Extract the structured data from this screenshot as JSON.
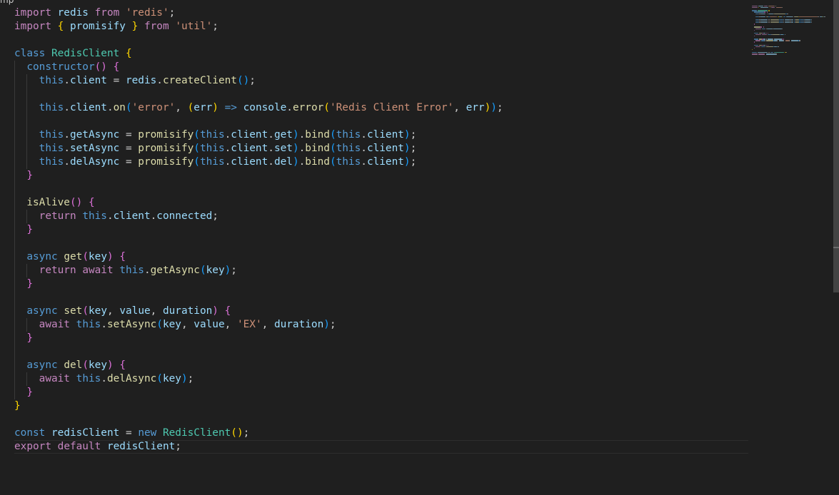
{
  "editor": {
    "breadcrumb": "mp",
    "language": "javascript",
    "cursor_line": 33
  },
  "colors": {
    "background": "#1f1f1f",
    "default": "#cccccc",
    "keyword": "#c586c0",
    "storage": "#569cd6",
    "class": "#4ec9b0",
    "function": "#dcdcaa",
    "string": "#ce9178",
    "variable": "#9cdcfe",
    "bracket1": "#ffd700",
    "bracket2": "#da70d6",
    "bracket3": "#179fff"
  },
  "code": {
    "lines": [
      {
        "indent": 0,
        "tokens": [
          {
            "t": "import",
            "c": "keyword"
          },
          {
            "t": " redis ",
            "c": "variable"
          },
          {
            "t": "from",
            "c": "keyword"
          },
          {
            "t": " ",
            "c": "default"
          },
          {
            "t": "'redis'",
            "c": "string"
          },
          {
            "t": ";",
            "c": "default"
          }
        ]
      },
      {
        "indent": 0,
        "tokens": [
          {
            "t": "import",
            "c": "keyword"
          },
          {
            "t": " ",
            "c": "default"
          },
          {
            "t": "{",
            "c": "bracket1"
          },
          {
            "t": " promisify ",
            "c": "variable"
          },
          {
            "t": "}",
            "c": "bracket1"
          },
          {
            "t": " ",
            "c": "default"
          },
          {
            "t": "from",
            "c": "keyword"
          },
          {
            "t": " ",
            "c": "default"
          },
          {
            "t": "'util'",
            "c": "string"
          },
          {
            "t": ";",
            "c": "default"
          }
        ]
      },
      {
        "indent": 0,
        "tokens": []
      },
      {
        "indent": 0,
        "tokens": [
          {
            "t": "class",
            "c": "storage"
          },
          {
            "t": " ",
            "c": "default"
          },
          {
            "t": "RedisClient",
            "c": "class"
          },
          {
            "t": " ",
            "c": "default"
          },
          {
            "t": "{",
            "c": "bracket1"
          }
        ]
      },
      {
        "indent": 1,
        "tokens": [
          {
            "t": "constructor",
            "c": "storage"
          },
          {
            "t": "()",
            "c": "bracket2"
          },
          {
            "t": " ",
            "c": "default"
          },
          {
            "t": "{",
            "c": "bracket2"
          }
        ]
      },
      {
        "indent": 2,
        "tokens": [
          {
            "t": "this",
            "c": "storage"
          },
          {
            "t": ".",
            "c": "default"
          },
          {
            "t": "client",
            "c": "variable"
          },
          {
            "t": " = ",
            "c": "default"
          },
          {
            "t": "redis",
            "c": "variable"
          },
          {
            "t": ".",
            "c": "default"
          },
          {
            "t": "createClient",
            "c": "function"
          },
          {
            "t": "()",
            "c": "bracket3"
          },
          {
            "t": ";",
            "c": "default"
          }
        ]
      },
      {
        "indent": 2,
        "tokens": []
      },
      {
        "indent": 2,
        "tokens": [
          {
            "t": "this",
            "c": "storage"
          },
          {
            "t": ".",
            "c": "default"
          },
          {
            "t": "client",
            "c": "variable"
          },
          {
            "t": ".",
            "c": "default"
          },
          {
            "t": "on",
            "c": "function"
          },
          {
            "t": "(",
            "c": "bracket3"
          },
          {
            "t": "'error'",
            "c": "string"
          },
          {
            "t": ", ",
            "c": "default"
          },
          {
            "t": "(",
            "c": "bracket1"
          },
          {
            "t": "err",
            "c": "variable"
          },
          {
            "t": ")",
            "c": "bracket1"
          },
          {
            "t": " ",
            "c": "default"
          },
          {
            "t": "=>",
            "c": "storage"
          },
          {
            "t": " ",
            "c": "default"
          },
          {
            "t": "console",
            "c": "variable"
          },
          {
            "t": ".",
            "c": "default"
          },
          {
            "t": "error",
            "c": "function"
          },
          {
            "t": "(",
            "c": "bracket1"
          },
          {
            "t": "'Redis Client Error'",
            "c": "string"
          },
          {
            "t": ", ",
            "c": "default"
          },
          {
            "t": "err",
            "c": "variable"
          },
          {
            "t": ")",
            "c": "bracket1"
          },
          {
            "t": ")",
            "c": "bracket3"
          },
          {
            "t": ";",
            "c": "default"
          }
        ]
      },
      {
        "indent": 2,
        "tokens": []
      },
      {
        "indent": 2,
        "tokens": [
          {
            "t": "this",
            "c": "storage"
          },
          {
            "t": ".",
            "c": "default"
          },
          {
            "t": "getAsync",
            "c": "variable"
          },
          {
            "t": " = ",
            "c": "default"
          },
          {
            "t": "promisify",
            "c": "function"
          },
          {
            "t": "(",
            "c": "bracket3"
          },
          {
            "t": "this",
            "c": "storage"
          },
          {
            "t": ".",
            "c": "default"
          },
          {
            "t": "client",
            "c": "variable"
          },
          {
            "t": ".",
            "c": "default"
          },
          {
            "t": "get",
            "c": "variable"
          },
          {
            "t": ")",
            "c": "bracket3"
          },
          {
            "t": ".",
            "c": "default"
          },
          {
            "t": "bind",
            "c": "function"
          },
          {
            "t": "(",
            "c": "bracket3"
          },
          {
            "t": "this",
            "c": "storage"
          },
          {
            "t": ".",
            "c": "default"
          },
          {
            "t": "client",
            "c": "variable"
          },
          {
            "t": ")",
            "c": "bracket3"
          },
          {
            "t": ";",
            "c": "default"
          }
        ]
      },
      {
        "indent": 2,
        "tokens": [
          {
            "t": "this",
            "c": "storage"
          },
          {
            "t": ".",
            "c": "default"
          },
          {
            "t": "setAsync",
            "c": "variable"
          },
          {
            "t": " = ",
            "c": "default"
          },
          {
            "t": "promisify",
            "c": "function"
          },
          {
            "t": "(",
            "c": "bracket3"
          },
          {
            "t": "this",
            "c": "storage"
          },
          {
            "t": ".",
            "c": "default"
          },
          {
            "t": "client",
            "c": "variable"
          },
          {
            "t": ".",
            "c": "default"
          },
          {
            "t": "set",
            "c": "variable"
          },
          {
            "t": ")",
            "c": "bracket3"
          },
          {
            "t": ".",
            "c": "default"
          },
          {
            "t": "bind",
            "c": "function"
          },
          {
            "t": "(",
            "c": "bracket3"
          },
          {
            "t": "this",
            "c": "storage"
          },
          {
            "t": ".",
            "c": "default"
          },
          {
            "t": "client",
            "c": "variable"
          },
          {
            "t": ")",
            "c": "bracket3"
          },
          {
            "t": ";",
            "c": "default"
          }
        ]
      },
      {
        "indent": 2,
        "tokens": [
          {
            "t": "this",
            "c": "storage"
          },
          {
            "t": ".",
            "c": "default"
          },
          {
            "t": "delAsync",
            "c": "variable"
          },
          {
            "t": " = ",
            "c": "default"
          },
          {
            "t": "promisify",
            "c": "function"
          },
          {
            "t": "(",
            "c": "bracket3"
          },
          {
            "t": "this",
            "c": "storage"
          },
          {
            "t": ".",
            "c": "default"
          },
          {
            "t": "client",
            "c": "variable"
          },
          {
            "t": ".",
            "c": "default"
          },
          {
            "t": "del",
            "c": "variable"
          },
          {
            "t": ")",
            "c": "bracket3"
          },
          {
            "t": ".",
            "c": "default"
          },
          {
            "t": "bind",
            "c": "function"
          },
          {
            "t": "(",
            "c": "bracket3"
          },
          {
            "t": "this",
            "c": "storage"
          },
          {
            "t": ".",
            "c": "default"
          },
          {
            "t": "client",
            "c": "variable"
          },
          {
            "t": ")",
            "c": "bracket3"
          },
          {
            "t": ";",
            "c": "default"
          }
        ]
      },
      {
        "indent": 1,
        "tokens": [
          {
            "t": "}",
            "c": "bracket2"
          }
        ]
      },
      {
        "indent": 1,
        "tokens": []
      },
      {
        "indent": 1,
        "tokens": [
          {
            "t": "isAlive",
            "c": "function"
          },
          {
            "t": "()",
            "c": "bracket2"
          },
          {
            "t": " ",
            "c": "default"
          },
          {
            "t": "{",
            "c": "bracket2"
          }
        ]
      },
      {
        "indent": 2,
        "tokens": [
          {
            "t": "return",
            "c": "keyword"
          },
          {
            "t": " ",
            "c": "default"
          },
          {
            "t": "this",
            "c": "storage"
          },
          {
            "t": ".",
            "c": "default"
          },
          {
            "t": "client",
            "c": "variable"
          },
          {
            "t": ".",
            "c": "default"
          },
          {
            "t": "connected",
            "c": "variable"
          },
          {
            "t": ";",
            "c": "default"
          }
        ]
      },
      {
        "indent": 1,
        "tokens": [
          {
            "t": "}",
            "c": "bracket2"
          }
        ]
      },
      {
        "indent": 1,
        "tokens": []
      },
      {
        "indent": 1,
        "tokens": [
          {
            "t": "async",
            "c": "storage"
          },
          {
            "t": " ",
            "c": "default"
          },
          {
            "t": "get",
            "c": "function"
          },
          {
            "t": "(",
            "c": "bracket2"
          },
          {
            "t": "key",
            "c": "variable"
          },
          {
            "t": ")",
            "c": "bracket2"
          },
          {
            "t": " ",
            "c": "default"
          },
          {
            "t": "{",
            "c": "bracket2"
          }
        ]
      },
      {
        "indent": 2,
        "tokens": [
          {
            "t": "return",
            "c": "keyword"
          },
          {
            "t": " ",
            "c": "default"
          },
          {
            "t": "await",
            "c": "keyword"
          },
          {
            "t": " ",
            "c": "default"
          },
          {
            "t": "this",
            "c": "storage"
          },
          {
            "t": ".",
            "c": "default"
          },
          {
            "t": "getAsync",
            "c": "function"
          },
          {
            "t": "(",
            "c": "bracket3"
          },
          {
            "t": "key",
            "c": "variable"
          },
          {
            "t": ")",
            "c": "bracket3"
          },
          {
            "t": ";",
            "c": "default"
          }
        ]
      },
      {
        "indent": 1,
        "tokens": [
          {
            "t": "}",
            "c": "bracket2"
          }
        ]
      },
      {
        "indent": 1,
        "tokens": []
      },
      {
        "indent": 1,
        "tokens": [
          {
            "t": "async",
            "c": "storage"
          },
          {
            "t": " ",
            "c": "default"
          },
          {
            "t": "set",
            "c": "function"
          },
          {
            "t": "(",
            "c": "bracket2"
          },
          {
            "t": "key",
            "c": "variable"
          },
          {
            "t": ", ",
            "c": "default"
          },
          {
            "t": "value",
            "c": "variable"
          },
          {
            "t": ", ",
            "c": "default"
          },
          {
            "t": "duration",
            "c": "variable"
          },
          {
            "t": ")",
            "c": "bracket2"
          },
          {
            "t": " ",
            "c": "default"
          },
          {
            "t": "{",
            "c": "bracket2"
          }
        ]
      },
      {
        "indent": 2,
        "tokens": [
          {
            "t": "await",
            "c": "keyword"
          },
          {
            "t": " ",
            "c": "default"
          },
          {
            "t": "this",
            "c": "storage"
          },
          {
            "t": ".",
            "c": "default"
          },
          {
            "t": "setAsync",
            "c": "function"
          },
          {
            "t": "(",
            "c": "bracket3"
          },
          {
            "t": "key",
            "c": "variable"
          },
          {
            "t": ", ",
            "c": "default"
          },
          {
            "t": "value",
            "c": "variable"
          },
          {
            "t": ", ",
            "c": "default"
          },
          {
            "t": "'EX'",
            "c": "string"
          },
          {
            "t": ", ",
            "c": "default"
          },
          {
            "t": "duration",
            "c": "variable"
          },
          {
            "t": ")",
            "c": "bracket3"
          },
          {
            "t": ";",
            "c": "default"
          }
        ]
      },
      {
        "indent": 1,
        "tokens": [
          {
            "t": "}",
            "c": "bracket2"
          }
        ]
      },
      {
        "indent": 1,
        "tokens": []
      },
      {
        "indent": 1,
        "tokens": [
          {
            "t": "async",
            "c": "storage"
          },
          {
            "t": " ",
            "c": "default"
          },
          {
            "t": "del",
            "c": "function"
          },
          {
            "t": "(",
            "c": "bracket2"
          },
          {
            "t": "key",
            "c": "variable"
          },
          {
            "t": ")",
            "c": "bracket2"
          },
          {
            "t": " ",
            "c": "default"
          },
          {
            "t": "{",
            "c": "bracket2"
          }
        ]
      },
      {
        "indent": 2,
        "tokens": [
          {
            "t": "await",
            "c": "keyword"
          },
          {
            "t": " ",
            "c": "default"
          },
          {
            "t": "this",
            "c": "storage"
          },
          {
            "t": ".",
            "c": "default"
          },
          {
            "t": "delAsync",
            "c": "function"
          },
          {
            "t": "(",
            "c": "bracket3"
          },
          {
            "t": "key",
            "c": "variable"
          },
          {
            "t": ")",
            "c": "bracket3"
          },
          {
            "t": ";",
            "c": "default"
          }
        ]
      },
      {
        "indent": 1,
        "tokens": [
          {
            "t": "}",
            "c": "bracket2"
          }
        ]
      },
      {
        "indent": 0,
        "tokens": [
          {
            "t": "}",
            "c": "bracket1"
          }
        ]
      },
      {
        "indent": 0,
        "tokens": []
      },
      {
        "indent": 0,
        "tokens": [
          {
            "t": "const",
            "c": "storage"
          },
          {
            "t": " ",
            "c": "default"
          },
          {
            "t": "redisClient",
            "c": "variable"
          },
          {
            "t": " = ",
            "c": "default"
          },
          {
            "t": "new",
            "c": "storage"
          },
          {
            "t": " ",
            "c": "default"
          },
          {
            "t": "RedisClient",
            "c": "class"
          },
          {
            "t": "()",
            "c": "bracket1"
          },
          {
            "t": ";",
            "c": "default"
          }
        ]
      },
      {
        "indent": 0,
        "tokens": [
          {
            "t": "export",
            "c": "keyword"
          },
          {
            "t": " ",
            "c": "default"
          },
          {
            "t": "default",
            "c": "keyword"
          },
          {
            "t": " ",
            "c": "default"
          },
          {
            "t": "redisClient",
            "c": "variable"
          },
          {
            "t": ";",
            "c": "default"
          }
        ]
      }
    ]
  }
}
